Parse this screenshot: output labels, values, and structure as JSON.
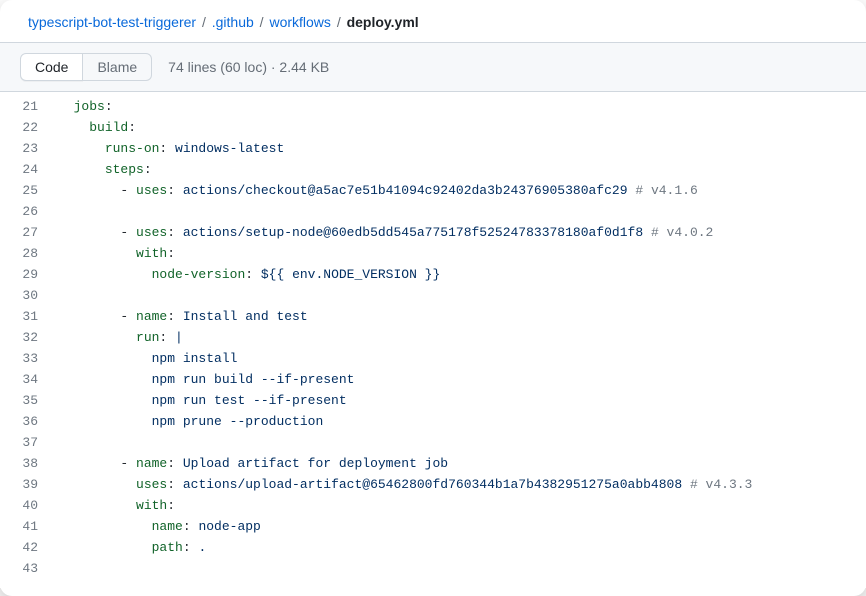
{
  "breadcrumb": {
    "repo": "typescript-bot-test-triggerer",
    "parts": [
      ".github",
      "workflows"
    ],
    "current": "deploy.yml"
  },
  "tabs": {
    "code": "Code",
    "blame": "Blame"
  },
  "meta": "74 lines (60 loc) · 2.44 KB",
  "lines": [
    {
      "n": 21,
      "tokens": [
        {
          "c": "pl-ent",
          "t": "jobs"
        },
        {
          "t": ":"
        }
      ],
      "indent": 2
    },
    {
      "n": 22,
      "tokens": [
        {
          "c": "pl-ent",
          "t": "build"
        },
        {
          "t": ":"
        }
      ],
      "indent": 4
    },
    {
      "n": 23,
      "tokens": [
        {
          "c": "pl-ent",
          "t": "runs-on"
        },
        {
          "t": ": "
        },
        {
          "c": "pl-s",
          "t": "windows-latest"
        }
      ],
      "indent": 6
    },
    {
      "n": 24,
      "tokens": [
        {
          "c": "pl-ent",
          "t": "steps"
        },
        {
          "t": ":"
        }
      ],
      "indent": 6
    },
    {
      "n": 25,
      "tokens": [
        {
          "t": "- "
        },
        {
          "c": "pl-ent",
          "t": "uses"
        },
        {
          "t": ": "
        },
        {
          "c": "pl-s",
          "t": "actions/checkout@a5ac7e51b41094c92402da3b24376905380afc29"
        },
        {
          "t": " "
        },
        {
          "c": "pl-c",
          "t": "# v4.1.6"
        }
      ],
      "indent": 8
    },
    {
      "n": 26,
      "tokens": [],
      "indent": 0
    },
    {
      "n": 27,
      "tokens": [
        {
          "t": "- "
        },
        {
          "c": "pl-ent",
          "t": "uses"
        },
        {
          "t": ": "
        },
        {
          "c": "pl-s",
          "t": "actions/setup-node@60edb5dd545a775178f52524783378180af0d1f8"
        },
        {
          "t": " "
        },
        {
          "c": "pl-c",
          "t": "# v4.0.2"
        }
      ],
      "indent": 8
    },
    {
      "n": 28,
      "tokens": [
        {
          "c": "pl-ent",
          "t": "with"
        },
        {
          "t": ":"
        }
      ],
      "indent": 10
    },
    {
      "n": 29,
      "tokens": [
        {
          "c": "pl-ent",
          "t": "node-version"
        },
        {
          "t": ": "
        },
        {
          "c": "pl-s",
          "t": "${{ env.NODE_VERSION }}"
        }
      ],
      "indent": 12
    },
    {
      "n": 30,
      "tokens": [],
      "indent": 0
    },
    {
      "n": 31,
      "tokens": [
        {
          "t": "- "
        },
        {
          "c": "pl-ent",
          "t": "name"
        },
        {
          "t": ": "
        },
        {
          "c": "pl-s",
          "t": "Install and test"
        }
      ],
      "indent": 8
    },
    {
      "n": 32,
      "tokens": [
        {
          "c": "pl-ent",
          "t": "run"
        },
        {
          "t": ": "
        },
        {
          "c": "pl-s",
          "t": "|"
        }
      ],
      "indent": 10
    },
    {
      "n": 33,
      "tokens": [
        {
          "c": "pl-s",
          "t": "npm install"
        }
      ],
      "indent": 12
    },
    {
      "n": 34,
      "tokens": [
        {
          "c": "pl-s",
          "t": "npm run build --if-present"
        }
      ],
      "indent": 12
    },
    {
      "n": 35,
      "tokens": [
        {
          "c": "pl-s",
          "t": "npm run test --if-present"
        }
      ],
      "indent": 12
    },
    {
      "n": 36,
      "tokens": [
        {
          "c": "pl-s",
          "t": "npm prune --production"
        }
      ],
      "indent": 12
    },
    {
      "n": 37,
      "tokens": [],
      "indent": 0
    },
    {
      "n": 38,
      "tokens": [
        {
          "t": "- "
        },
        {
          "c": "pl-ent",
          "t": "name"
        },
        {
          "t": ": "
        },
        {
          "c": "pl-s",
          "t": "Upload artifact for deployment job"
        }
      ],
      "indent": 8
    },
    {
      "n": 39,
      "tokens": [
        {
          "c": "pl-ent",
          "t": "uses"
        },
        {
          "t": ": "
        },
        {
          "c": "pl-s",
          "t": "actions/upload-artifact@65462800fd760344b1a7b4382951275a0abb4808"
        },
        {
          "t": " "
        },
        {
          "c": "pl-c",
          "t": "# v4.3.3"
        }
      ],
      "indent": 10
    },
    {
      "n": 40,
      "tokens": [
        {
          "c": "pl-ent",
          "t": "with"
        },
        {
          "t": ":"
        }
      ],
      "indent": 10
    },
    {
      "n": 41,
      "tokens": [
        {
          "c": "pl-ent",
          "t": "name"
        },
        {
          "t": ": "
        },
        {
          "c": "pl-s",
          "t": "node-app"
        }
      ],
      "indent": 12
    },
    {
      "n": 42,
      "tokens": [
        {
          "c": "pl-ent",
          "t": "path"
        },
        {
          "t": ": "
        },
        {
          "c": "pl-s",
          "t": "."
        }
      ],
      "indent": 12
    },
    {
      "n": 43,
      "tokens": [],
      "indent": 0
    }
  ]
}
